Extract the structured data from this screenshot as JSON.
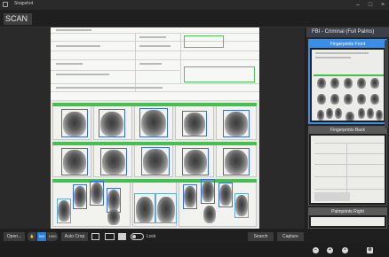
{
  "window": {
    "title": "Snapshot",
    "controls": [
      "–",
      "□",
      "×"
    ]
  },
  "tabs": {
    "scan_label": "SCAN"
  },
  "right_panel": {
    "title": "FBI - Criminal (Full Palms)",
    "thumbnails": [
      {
        "label": "Fingerprints Front",
        "active": true
      },
      {
        "label": "Fingerprints Back",
        "active": false
      },
      {
        "label": "Palmprints Right",
        "active": false
      }
    ]
  },
  "toolbar": {
    "open_label": "Open...",
    "seg_options": [
      "1",
      "500",
      "1000"
    ],
    "seg_selected": "500",
    "autocrop_label": "Auto Crop",
    "lock_label": "Lock",
    "search_label": "Search",
    "capture_label": "Capture"
  },
  "colors": {
    "accent": "#2a7fd8",
    "finger_box": "#3c6de0",
    "card_bar": "#45c050"
  },
  "icons": [
    "app-icon",
    "hand-icon",
    "crop-square-icon",
    "crop-rect-icon",
    "save-icon",
    "lock-toggle",
    "zoom-in-icon",
    "zoom-out-icon",
    "settings-icon"
  ]
}
